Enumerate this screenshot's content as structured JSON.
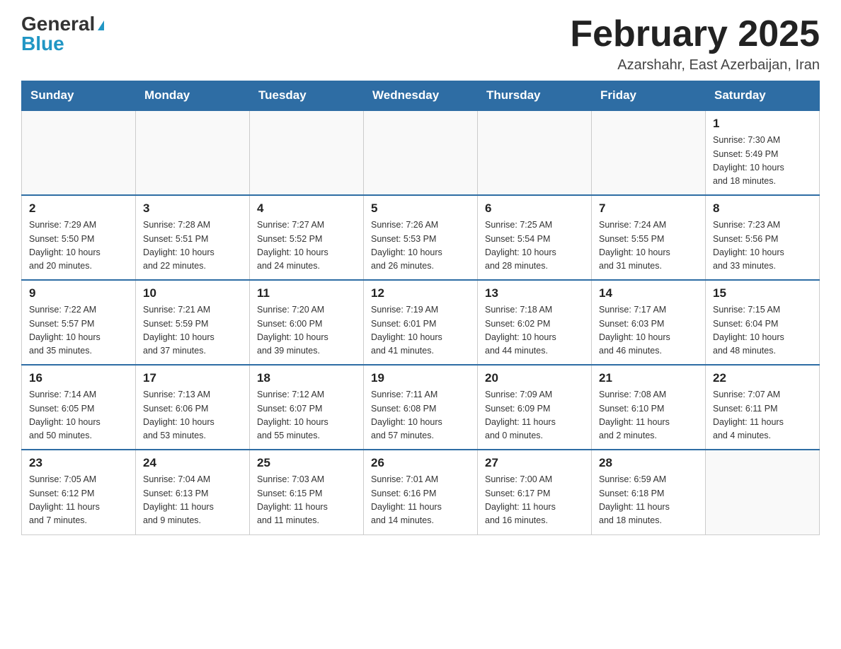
{
  "header": {
    "logo_general": "General",
    "logo_blue": "Blue",
    "title": "February 2025",
    "subtitle": "Azarshahr, East Azerbaijan, Iran"
  },
  "days_of_week": [
    "Sunday",
    "Monday",
    "Tuesday",
    "Wednesday",
    "Thursday",
    "Friday",
    "Saturday"
  ],
  "weeks": [
    [
      {
        "day": "",
        "info": ""
      },
      {
        "day": "",
        "info": ""
      },
      {
        "day": "",
        "info": ""
      },
      {
        "day": "",
        "info": ""
      },
      {
        "day": "",
        "info": ""
      },
      {
        "day": "",
        "info": ""
      },
      {
        "day": "1",
        "info": "Sunrise: 7:30 AM\nSunset: 5:49 PM\nDaylight: 10 hours\nand 18 minutes."
      }
    ],
    [
      {
        "day": "2",
        "info": "Sunrise: 7:29 AM\nSunset: 5:50 PM\nDaylight: 10 hours\nand 20 minutes."
      },
      {
        "day": "3",
        "info": "Sunrise: 7:28 AM\nSunset: 5:51 PM\nDaylight: 10 hours\nand 22 minutes."
      },
      {
        "day": "4",
        "info": "Sunrise: 7:27 AM\nSunset: 5:52 PM\nDaylight: 10 hours\nand 24 minutes."
      },
      {
        "day": "5",
        "info": "Sunrise: 7:26 AM\nSunset: 5:53 PM\nDaylight: 10 hours\nand 26 minutes."
      },
      {
        "day": "6",
        "info": "Sunrise: 7:25 AM\nSunset: 5:54 PM\nDaylight: 10 hours\nand 28 minutes."
      },
      {
        "day": "7",
        "info": "Sunrise: 7:24 AM\nSunset: 5:55 PM\nDaylight: 10 hours\nand 31 minutes."
      },
      {
        "day": "8",
        "info": "Sunrise: 7:23 AM\nSunset: 5:56 PM\nDaylight: 10 hours\nand 33 minutes."
      }
    ],
    [
      {
        "day": "9",
        "info": "Sunrise: 7:22 AM\nSunset: 5:57 PM\nDaylight: 10 hours\nand 35 minutes."
      },
      {
        "day": "10",
        "info": "Sunrise: 7:21 AM\nSunset: 5:59 PM\nDaylight: 10 hours\nand 37 minutes."
      },
      {
        "day": "11",
        "info": "Sunrise: 7:20 AM\nSunset: 6:00 PM\nDaylight: 10 hours\nand 39 minutes."
      },
      {
        "day": "12",
        "info": "Sunrise: 7:19 AM\nSunset: 6:01 PM\nDaylight: 10 hours\nand 41 minutes."
      },
      {
        "day": "13",
        "info": "Sunrise: 7:18 AM\nSunset: 6:02 PM\nDaylight: 10 hours\nand 44 minutes."
      },
      {
        "day": "14",
        "info": "Sunrise: 7:17 AM\nSunset: 6:03 PM\nDaylight: 10 hours\nand 46 minutes."
      },
      {
        "day": "15",
        "info": "Sunrise: 7:15 AM\nSunset: 6:04 PM\nDaylight: 10 hours\nand 48 minutes."
      }
    ],
    [
      {
        "day": "16",
        "info": "Sunrise: 7:14 AM\nSunset: 6:05 PM\nDaylight: 10 hours\nand 50 minutes."
      },
      {
        "day": "17",
        "info": "Sunrise: 7:13 AM\nSunset: 6:06 PM\nDaylight: 10 hours\nand 53 minutes."
      },
      {
        "day": "18",
        "info": "Sunrise: 7:12 AM\nSunset: 6:07 PM\nDaylight: 10 hours\nand 55 minutes."
      },
      {
        "day": "19",
        "info": "Sunrise: 7:11 AM\nSunset: 6:08 PM\nDaylight: 10 hours\nand 57 minutes."
      },
      {
        "day": "20",
        "info": "Sunrise: 7:09 AM\nSunset: 6:09 PM\nDaylight: 11 hours\nand 0 minutes."
      },
      {
        "day": "21",
        "info": "Sunrise: 7:08 AM\nSunset: 6:10 PM\nDaylight: 11 hours\nand 2 minutes."
      },
      {
        "day": "22",
        "info": "Sunrise: 7:07 AM\nSunset: 6:11 PM\nDaylight: 11 hours\nand 4 minutes."
      }
    ],
    [
      {
        "day": "23",
        "info": "Sunrise: 7:05 AM\nSunset: 6:12 PM\nDaylight: 11 hours\nand 7 minutes."
      },
      {
        "day": "24",
        "info": "Sunrise: 7:04 AM\nSunset: 6:13 PM\nDaylight: 11 hours\nand 9 minutes."
      },
      {
        "day": "25",
        "info": "Sunrise: 7:03 AM\nSunset: 6:15 PM\nDaylight: 11 hours\nand 11 minutes."
      },
      {
        "day": "26",
        "info": "Sunrise: 7:01 AM\nSunset: 6:16 PM\nDaylight: 11 hours\nand 14 minutes."
      },
      {
        "day": "27",
        "info": "Sunrise: 7:00 AM\nSunset: 6:17 PM\nDaylight: 11 hours\nand 16 minutes."
      },
      {
        "day": "28",
        "info": "Sunrise: 6:59 AM\nSunset: 6:18 PM\nDaylight: 11 hours\nand 18 minutes."
      },
      {
        "day": "",
        "info": ""
      }
    ]
  ]
}
